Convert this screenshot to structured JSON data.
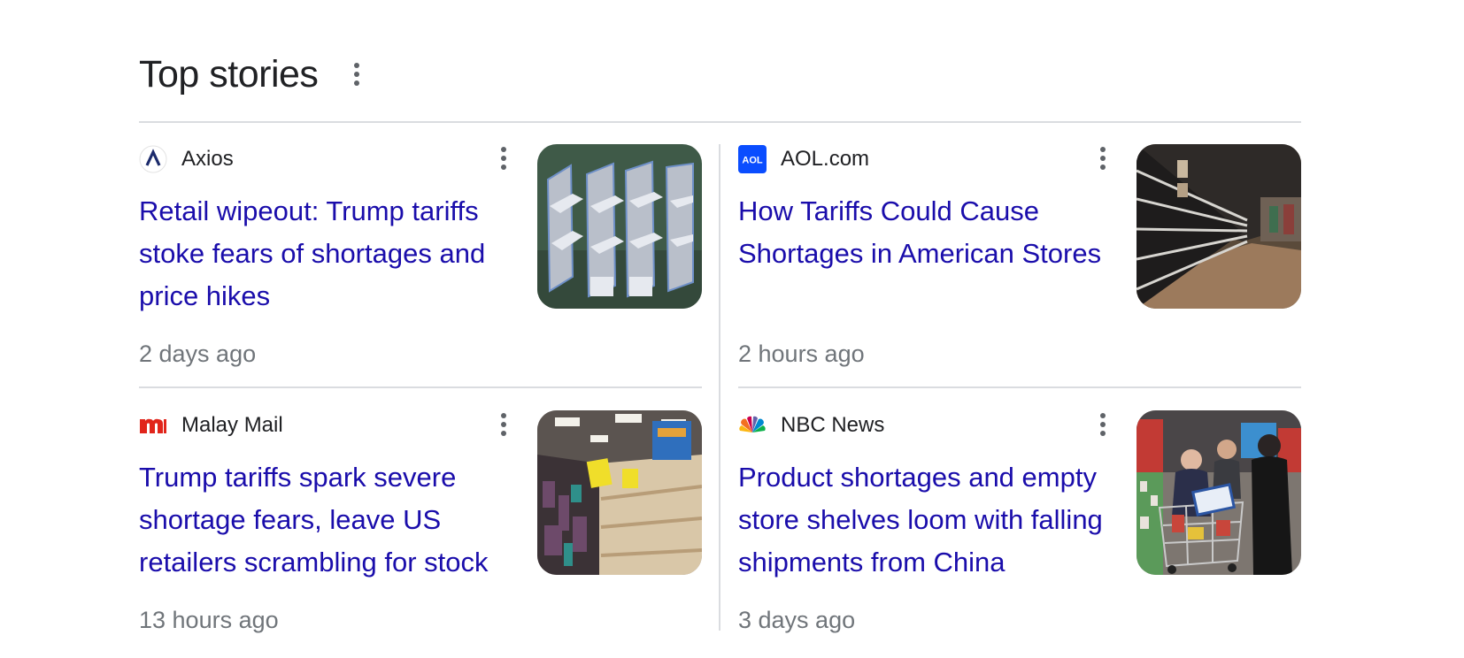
{
  "section": {
    "title": "Top stories",
    "menu_icon": "more-vert-icon"
  },
  "stories": [
    {
      "source": "Axios",
      "favicon": "axios-logo",
      "headline": "Retail wipeout: Trump tariffs stoke fears of shortages and price hikes",
      "time": "2 days ago",
      "thumbnail": "empty-shelves-illustration"
    },
    {
      "source": "AOL.com",
      "favicon": "aol-logo",
      "headline": "How Tariffs Could Cause Shortages in American Stores",
      "time": "2 hours ago",
      "thumbnail": "empty-store-aisle-photo"
    },
    {
      "source": "Malay Mail",
      "favicon": "malay-mail-logo",
      "headline": "Trump tariffs spark severe shortage fears, leave US retailers scrambling for stock",
      "time": "13 hours ago",
      "thumbnail": "bare-shelves-photo"
    },
    {
      "source": "NBC News",
      "favicon": "nbc-peacock-logo",
      "headline": "Product shortages and empty store shelves loom with falling shipments from China",
      "time": "3 days ago",
      "thumbnail": "shoppers-with-carts-photo"
    }
  ],
  "colors": {
    "headline_link": "#1a0dab",
    "source_text": "#202124",
    "timestamp": "#70757a",
    "divider": "#dadce0",
    "aol_brand": "#0a4dff",
    "malay_mail_brand": "#e1251b"
  }
}
